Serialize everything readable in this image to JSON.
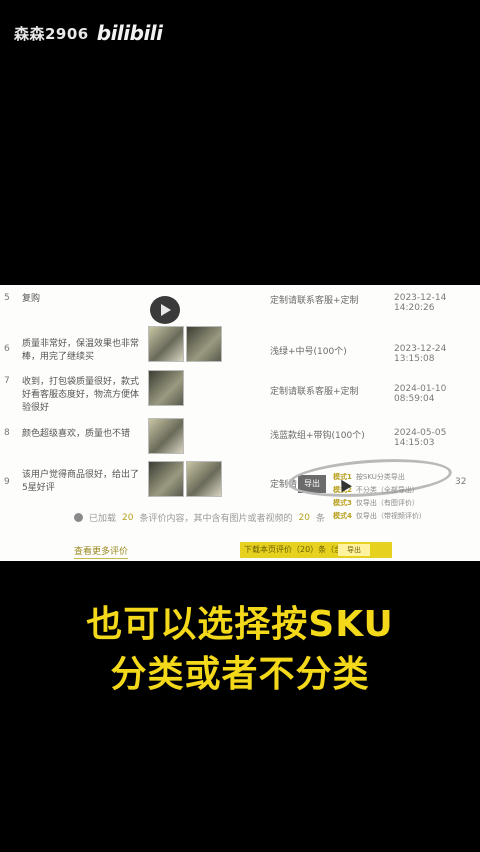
{
  "watermark": {
    "user": "森森2906",
    "logo": "bilibili"
  },
  "rows": [
    {
      "index": "5",
      "review": "复购",
      "sku": "定制请联系客服+定制",
      "time": "2023-12-14 14:20:26"
    },
    {
      "index": "6",
      "review": "质量非常好，保温效果也非常棒，用完了继续买",
      "sku": "浅绿+中号(100个)",
      "time": "2023-12-24 13:15:08"
    },
    {
      "index": "7",
      "review": "收到，打包袋质量很好，款式好看客服态度好，物流方便体验很好",
      "sku": "定制请联系客服+定制",
      "time": "2024-01-10 08:59:04"
    },
    {
      "index": "8",
      "review": "颜色超级喜欢，质量也不错",
      "sku": "浅蓝款组+带钩(100个)",
      "time": "2024-05-05 14:15:03"
    },
    {
      "index": "9",
      "review": "该用户觉得商品很好，给出了5星好评",
      "sku": "定制请",
      "time": "32"
    }
  ],
  "popup": {
    "tag": "导出",
    "options": [
      {
        "key": "模式1",
        "text": "按SKU分类导出"
      },
      {
        "key": "模式2",
        "text": "不分类（全部导出）"
      },
      {
        "key": "模式3",
        "text": "仅导出（有图评价）"
      },
      {
        "key": "模式4",
        "text": "仅导出（带视频评价）"
      }
    ]
  },
  "notice": {
    "prefix": "已加载",
    "count": "20",
    "middle": "条评价内容，其中含有图片或者视频的",
    "count2": "20",
    "suffix": "条"
  },
  "buttons": {
    "left": "查看更多评价",
    "right": "下载本页评价（20）条（含）",
    "right_inner": "导出"
  },
  "caption": {
    "line1": "也可以选择按SKU",
    "line2": "分类或者不分类"
  },
  "colors": {
    "caption": "#f4d81a",
    "accent": "#e6d21e",
    "background": "#000000"
  }
}
